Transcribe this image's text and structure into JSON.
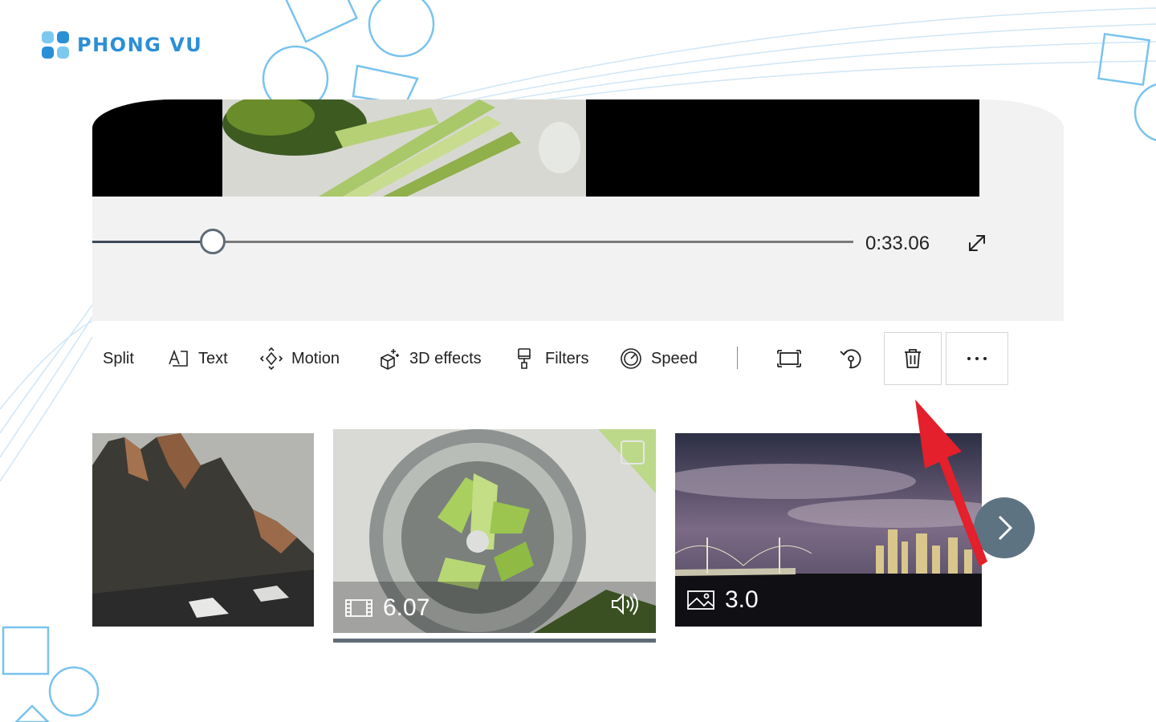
{
  "brand": {
    "name": "PHONG VU",
    "color": "#2b8fd6"
  },
  "player": {
    "time": "0:33.06",
    "progress": 0.16,
    "icons": {
      "fullscreen": "expand-icon"
    }
  },
  "toolbar": {
    "split_label": "Split",
    "text_label": "Text",
    "motion_label": "Motion",
    "effects3d_label": "3D effects",
    "filters_label": "Filters",
    "speed_label": "Speed",
    "icons": [
      "text-icon",
      "motion-icon",
      "3d-effects-icon",
      "filters-icon",
      "speed-icon",
      "resize-icon",
      "rotate-icon",
      "trash-icon",
      "more-icon"
    ]
  },
  "timeline": {
    "clips": [
      {
        "kind": "image",
        "duration": ""
      },
      {
        "kind": "video",
        "duration": "6.07",
        "has_audio": true,
        "selected": true
      },
      {
        "kind": "image",
        "duration": "3.0"
      }
    ]
  },
  "annotation": {
    "arrow_color": "#e3202b",
    "points_to": "trash-button"
  },
  "colors": {
    "accent": "#5e7381",
    "app_bg": "#f2f2f2"
  }
}
